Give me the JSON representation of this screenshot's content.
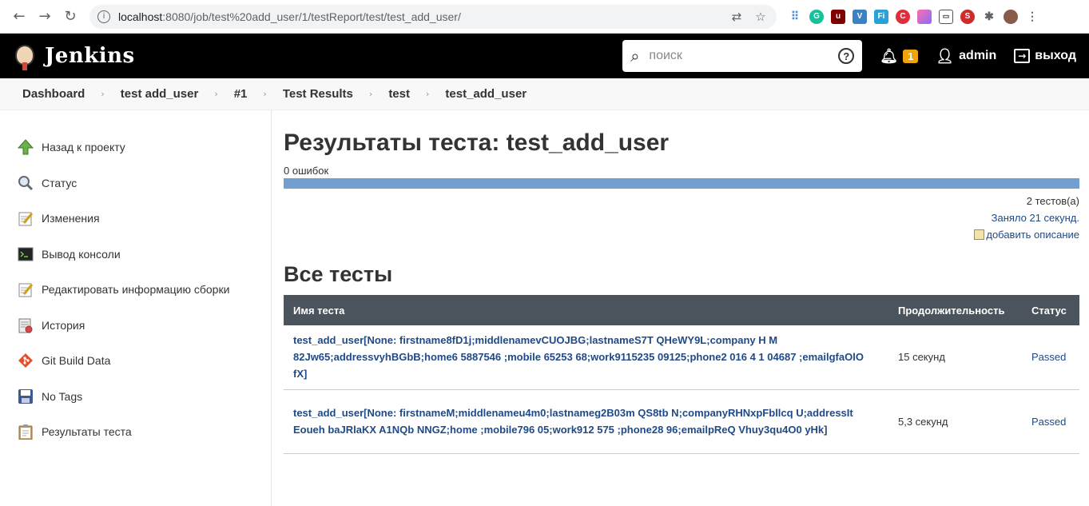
{
  "browser": {
    "url_host": "localhost",
    "url_path": ":8080/job/test%20add_user/1/testReport/test/test_add_user/"
  },
  "header": {
    "brand": "Jenkins",
    "search_placeholder": "поиск",
    "notifications_count": "1",
    "user": "admin",
    "logout": "выход"
  },
  "breadcrumbs": [
    "Dashboard",
    "test add_user",
    "#1",
    "Test Results",
    "test",
    "test_add_user"
  ],
  "sidebar": {
    "items": [
      {
        "label": "Назад к проекту",
        "icon": "up-arrow-icon"
      },
      {
        "label": "Статус",
        "icon": "magnifier-icon"
      },
      {
        "label": "Изменения",
        "icon": "notepad-icon"
      },
      {
        "label": "Вывод консоли",
        "icon": "terminal-icon"
      },
      {
        "label": "Редактировать информацию сборки",
        "icon": "notepad-icon"
      },
      {
        "label": "История",
        "icon": "history-icon"
      },
      {
        "label": "Git Build Data",
        "icon": "git-icon"
      },
      {
        "label": "No Tags",
        "icon": "floppy-icon"
      },
      {
        "label": "Результаты теста",
        "icon": "clipboard-icon"
      }
    ]
  },
  "main": {
    "title": "Результаты теста: test_add_user",
    "failures": "0 ошибок",
    "tests_count": "2 тестов(а)",
    "duration_text": "Заняло 21 секунд.",
    "add_description": "добавить описание",
    "all_tests_heading": "Все тесты",
    "columns": [
      "Имя теста",
      "Продолжительность",
      "Статус"
    ],
    "rows": [
      {
        "name": "test_add_user[None: firstname8fD1j;middlenamevCUOJBG;lastnameS7T QHeWY9L;company H M 82Jw65;addressvyhBGbB;home6 5887546 ;mobile 65253 68;work9115235 09125;phone2 016 4 1 04687 ;emailgfaOlO fX]",
        "duration": "15 секунд",
        "status": "Passed"
      },
      {
        "name": "test_add_user[None: firstnameM;middlenameu4m0;lastnameg2B03m QS8tb N;companyRHNxpFbllcq U;addressIt Eoueh baJRlaKX A1NQb NNGZ;home ;mobile796 05;work912 575 ;phone28 96;emailpReQ Vhuy3qu4O0 yHk]",
        "duration": "5,3 секунд",
        "status": "Passed"
      }
    ]
  },
  "colors": {
    "header_bg": "#000000",
    "progress_bar": "#729fcf",
    "table_header": "#4b535c",
    "link": "#204a87",
    "badge": "#f0a30a"
  }
}
